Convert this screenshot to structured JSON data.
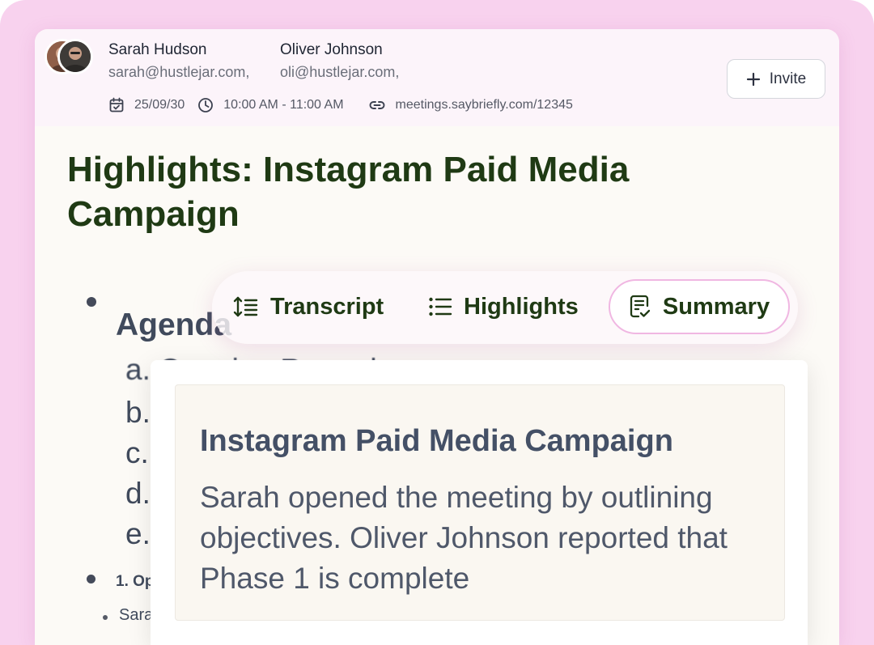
{
  "meeting": {
    "attendees": [
      {
        "name": "Sarah Hudson",
        "email": "sarah@hustlejar.com,"
      },
      {
        "name": "Oliver Johnson",
        "email": "oli@hustlejar.com,"
      }
    ],
    "date": "25/09/30",
    "time": "10:00 AM - 11:00 AM",
    "link": "meetings.saybriefly.com/12345",
    "invite_label": "Invite",
    "icons": {
      "date": "calendar-check-icon",
      "time": "clock-icon",
      "link": "link-icon",
      "invite": "plus-icon"
    }
  },
  "document": {
    "title": "Highlights: Instagram Paid Media Campaign",
    "agenda_heading": "Agenda",
    "agenda_items": [
      "a. Opening Remarks",
      "b.",
      "c.",
      "d.",
      "e."
    ],
    "sub_heading": "1. Op",
    "sub_text": "Sara"
  },
  "tabs": {
    "items": [
      {
        "label": "Transcript",
        "icon": "transcript-icon"
      },
      {
        "label": "Highlights",
        "icon": "list-icon"
      },
      {
        "label": "Summary",
        "icon": "summary-icon"
      }
    ],
    "active": "Summary"
  },
  "summary_popup": {
    "title": "Instagram Paid Media Campaign",
    "body": "Sarah opened the meeting by outlining objectives. Oliver Johnson reported that Phase 1 is complete"
  },
  "colors": {
    "frame": "#f8d2ee",
    "heading_green": "#1f3a14",
    "active_tab_border": "#f0b7e2",
    "body_text": "#404a5c"
  }
}
